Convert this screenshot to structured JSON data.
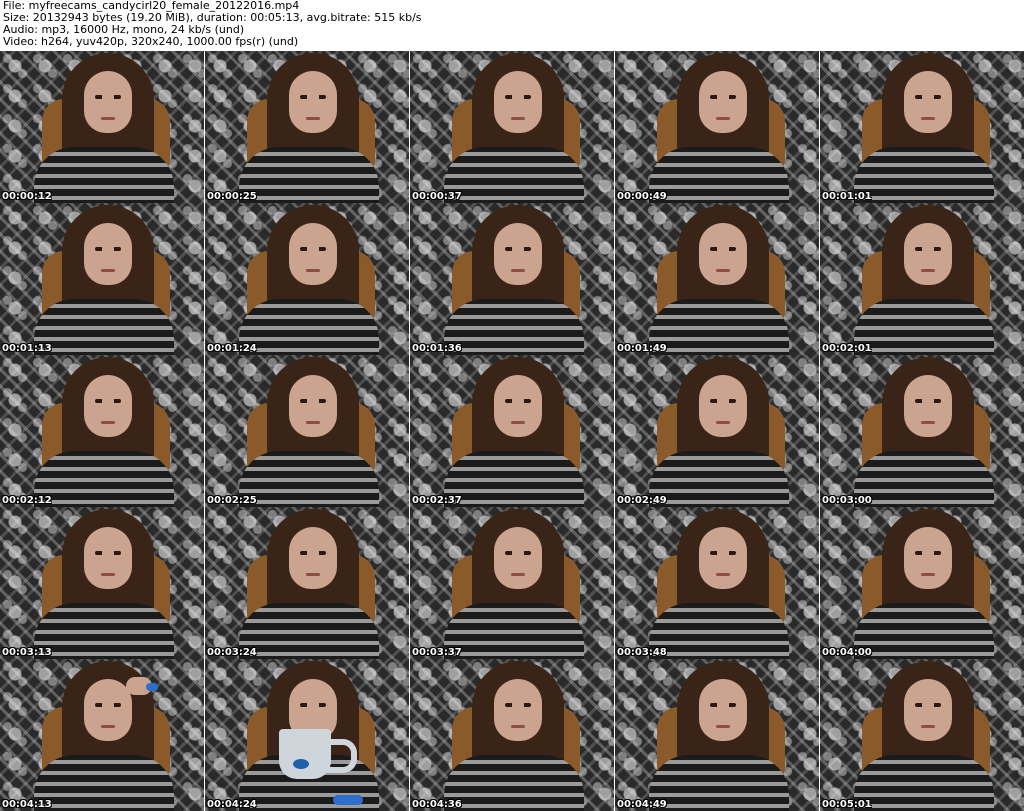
{
  "header": {
    "file": "File: myfreecams_candycirl20_female_20122016.mp4",
    "size": "Size: 20132943 bytes (19.20 MiB), duration: 00:05:13, avg.bitrate: 515 kb/s",
    "audio": "Audio: mp3, 16000 Hz, mono, 24 kb/s (und)",
    "video": "Video: h264, yuv420p, 320x240, 1000.00 fps(r) (und)"
  },
  "thumbnails": [
    {
      "timestamp": "00:00:12"
    },
    {
      "timestamp": "00:00:25"
    },
    {
      "timestamp": "00:00:37"
    },
    {
      "timestamp": "00:00:49"
    },
    {
      "timestamp": "00:01:01"
    },
    {
      "timestamp": "00:01:13"
    },
    {
      "timestamp": "00:01:24"
    },
    {
      "timestamp": "00:01:36"
    },
    {
      "timestamp": "00:01:49"
    },
    {
      "timestamp": "00:02:01"
    },
    {
      "timestamp": "00:02:12"
    },
    {
      "timestamp": "00:02:25"
    },
    {
      "timestamp": "00:02:37"
    },
    {
      "timestamp": "00:02:49"
    },
    {
      "timestamp": "00:03:00"
    },
    {
      "timestamp": "00:03:13"
    },
    {
      "timestamp": "00:03:24"
    },
    {
      "timestamp": "00:03:37"
    },
    {
      "timestamp": "00:03:48"
    },
    {
      "timestamp": "00:04:00"
    },
    {
      "timestamp": "00:04:13"
    },
    {
      "timestamp": "00:04:24"
    },
    {
      "timestamp": "00:04:36"
    },
    {
      "timestamp": "00:04:49"
    },
    {
      "timestamp": "00:05:01"
    }
  ]
}
